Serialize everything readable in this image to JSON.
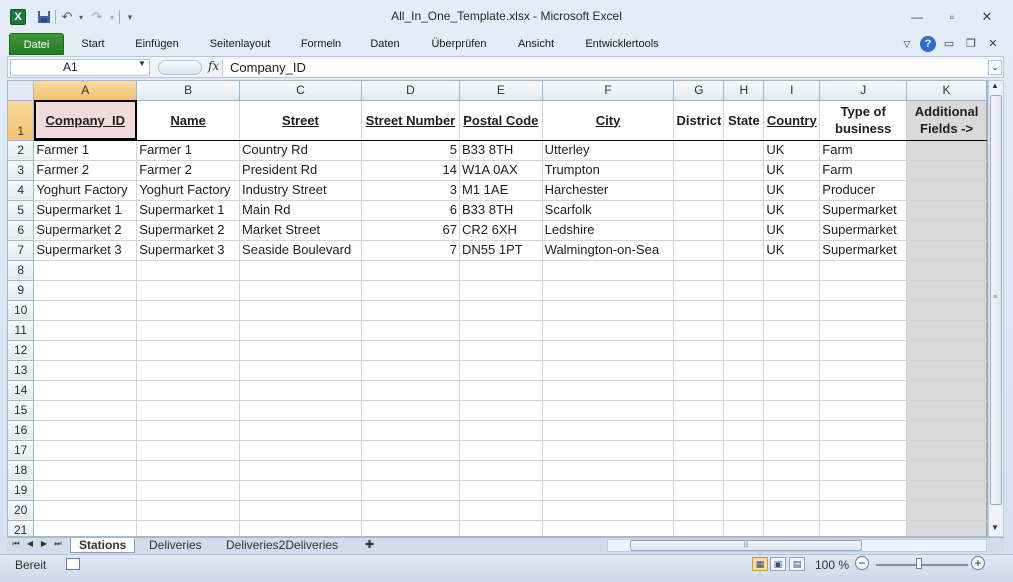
{
  "app": {
    "title": "All_In_One_Template.xlsx  -  Microsoft Excel",
    "logo": "X"
  },
  "ribbon": {
    "tabs": [
      "Datei",
      "Start",
      "Einfügen",
      "Seitenlayout",
      "Formeln",
      "Daten",
      "Überprüfen",
      "Ansicht",
      "Entwicklertools"
    ]
  },
  "formula_bar": {
    "name_box": "A1",
    "fx": "fx",
    "value": "Company_ID"
  },
  "grid": {
    "columns": [
      "A",
      "B",
      "C",
      "D",
      "E",
      "F",
      "G",
      "H",
      "I",
      "J",
      "K"
    ],
    "selected_cell": "A1",
    "header_row": [
      "Company_ID",
      "Name",
      "Street",
      "Street Number",
      "Postal Code",
      "City",
      "District",
      "State",
      "Country",
      "Type of business",
      "Additional Fields ->"
    ],
    "rows": [
      [
        "Farmer 1",
        "Farmer 1",
        "Country Rd",
        "5",
        "B33 8TH",
        "Utterley",
        "",
        "",
        "UK",
        "Farm",
        ""
      ],
      [
        "Farmer 2",
        "Farmer 2",
        "President Rd",
        "14",
        "W1A 0AX",
        "Trumpton",
        "",
        "",
        "UK",
        "Farm",
        ""
      ],
      [
        "Yoghurt Factory",
        "Yoghurt Factory",
        "Industry Street",
        "3",
        "M1 1AE",
        "Harchester",
        "",
        "",
        "UK",
        "Producer",
        ""
      ],
      [
        "Supermarket 1",
        "Supermarket 1",
        "Main Rd",
        "6",
        "B33 8TH",
        "Scarfolk",
        "",
        "",
        "UK",
        "Supermarket",
        ""
      ],
      [
        "Supermarket 2",
        "Supermarket 2",
        "Market Street",
        "67",
        "CR2 6XH",
        "Ledshire",
        "",
        "",
        "UK",
        "Supermarket",
        ""
      ],
      [
        "Supermarket 3",
        "Supermarket 3",
        "Seaside Boulevard",
        "7",
        "DN55 1PT",
        "Walmington-on-Sea",
        "",
        "",
        "UK",
        "Supermarket",
        ""
      ]
    ],
    "row_numbers": [
      "1",
      "2",
      "3",
      "4",
      "5",
      "6",
      "7",
      "8",
      "9",
      "10",
      "11",
      "12",
      "13",
      "14",
      "15",
      "16",
      "17",
      "18",
      "19",
      "20",
      "21"
    ]
  },
  "sheet_tabs": [
    "Stations",
    "Deliveries",
    "Deliveries2Deliveries"
  ],
  "active_sheet": "Stations",
  "status": {
    "text": "Bereit",
    "zoom": "100 %"
  },
  "icons": [
    "excel-logo-icon",
    "save-icon",
    "undo-icon",
    "redo-icon",
    "customize-qat-icon",
    "minimize-icon",
    "restore-icon",
    "close-icon",
    "ribbon-minimize-icon",
    "help-icon",
    "fx-icon",
    "new-sheet-icon",
    "macro-record-icon",
    "normal-view-icon",
    "page-layout-view-icon",
    "page-break-view-icon",
    "zoom-out-icon",
    "zoom-in-icon"
  ]
}
